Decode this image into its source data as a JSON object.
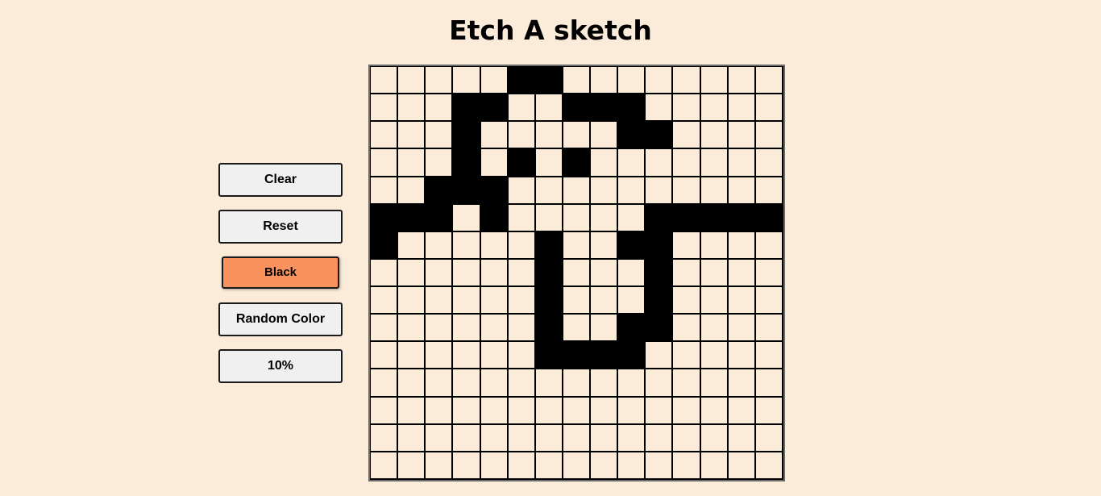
{
  "title": "Etch A sketch",
  "buttons": [
    {
      "label": "Clear",
      "name": "clear-button",
      "active": false
    },
    {
      "label": "Reset",
      "name": "reset-button",
      "active": false
    },
    {
      "label": "Black",
      "name": "black-button",
      "active": true
    },
    {
      "label": "Random Color",
      "name": "random-color-button",
      "active": false
    },
    {
      "label": "10%",
      "name": "shade-10-percent-button",
      "active": false
    }
  ],
  "colors": {
    "background": "#fbebd9",
    "cell_empty": "#fbebd9",
    "cell_filled": "#000000",
    "active_button": "#f9925e",
    "button": "#f0f0f0"
  },
  "grid": {
    "size": 15,
    "rows": [
      "000001100000000",
      "000110011100000",
      "000100000110000",
      "000101010000000",
      "001110000000000",
      "111010000011111",
      "100000100110000",
      "000000100010000",
      "000000100010000",
      "000000100110000",
      "000000111100000",
      "000000000000000",
      "000000000000000",
      "000000000000000",
      "000000000000000"
    ]
  }
}
